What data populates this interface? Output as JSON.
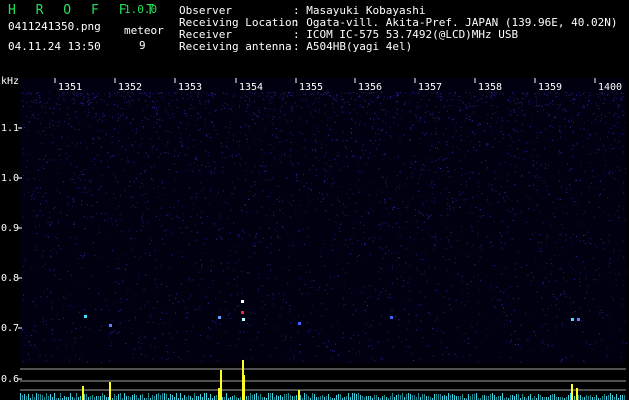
{
  "app": {
    "title": "H R O F F T",
    "version": "1.0.0"
  },
  "image": {
    "filename": "0411241350.png",
    "datetime": "04.11.24 13:50"
  },
  "meteor": {
    "label": "meteor",
    "count": "9"
  },
  "info": [
    {
      "label": "Observer",
      "value": ": Masayuki Kobayashi"
    },
    {
      "label": "Receiving Location",
      "value": ": Ogata-vill. Akita-Pref. JAPAN (139.96E, 40.02N)"
    },
    {
      "label": "Receiver",
      "value": ": ICOM IC-575 53.7492(@LCD)MHz USB"
    },
    {
      "label": "Receiving antenna",
      "value": ": A504HB(yagi 4el)"
    }
  ],
  "time_axis": [
    "1351",
    "1352",
    "1353",
    "1354",
    "1355",
    "1356",
    "1357",
    "1358",
    "1359",
    "1400"
  ],
  "freq_axis": {
    "unit": "kHz",
    "labels": [
      "1.1",
      "1.0",
      "0.9",
      "0.8",
      "0.7",
      "0.6"
    ]
  },
  "colors": {
    "background": "#000000",
    "header_green": "#22e05a",
    "noise_blue": "#1a1a8a",
    "echo_yellow": "#ffff20",
    "echo_red": "#ff2040",
    "echo_cyan": "#40e0ff"
  }
}
